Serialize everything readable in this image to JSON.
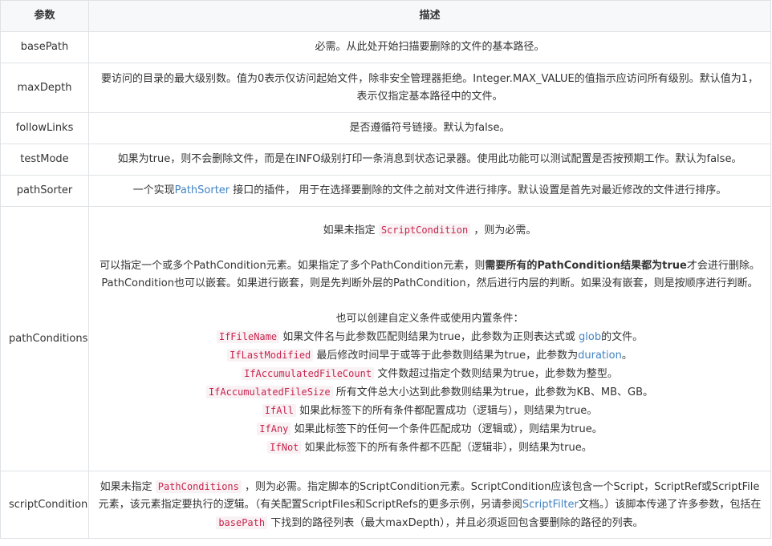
{
  "header": {
    "col1": "参数",
    "col2": "描述"
  },
  "rows": {
    "basePath": {
      "name": "basePath",
      "desc": "必需。从此处开始扫描要删除的文件的基本路径。"
    },
    "maxDepth": {
      "name": "maxDepth",
      "desc": "要访问的目录的最大级别数。值为0表示仅访问起始文件，除非安全管理器拒绝。Integer.MAX_VALUE的值指示应访问所有级别。默认值为1，表示仅指定基本路径中的文件。"
    },
    "followLinks": {
      "name": "followLinks",
      "desc": "是否遵循符号链接。默认为false。"
    },
    "testMode": {
      "name": "testMode",
      "desc": "如果为true，则不会删除文件，而是在INFO级别打印一条消息到状态记录器。使用此功能可以测试配置是否按预期工作。默认为false。"
    },
    "pathSorter": {
      "name": "pathSorter",
      "pre": "一个实现",
      "link": "PathSorter",
      "post": " 接口的插件， 用于在选择要删除的文件之前对文件进行排序。默认设置是首先对最近修改的文件进行排序。"
    },
    "pathConditions": {
      "name": "pathConditions",
      "p1_pre": "如果未指定 ",
      "p1_code": "ScriptCondition",
      "p1_post": " ，则为必需。",
      "p2_pre": "可以指定一个或多个PathCondition元素。如果指定了多个PathCondition元素，则",
      "p2_bold": "需要所有的PathCondition结果都为true",
      "p2_post": "才会进行删除。PathCondition也可以嵌套。如果进行嵌套，则是先判断外层的PathCondition，然后进行内层的判断。如果没有嵌套，则是按顺序进行判断。",
      "p3": "也可以创建自定义条件或使用内置条件：",
      "conds": [
        {
          "code": "IfFileName",
          "pre": " 如果文件名与此参数匹配则结果为true，此参数为正则表达式或 ",
          "link": "glob",
          "post": "的文件。"
        },
        {
          "code": "IfLastModified",
          "pre": " 最后修改时间早于或等于此参数则结果为true，此参数为",
          "link": "duration",
          "post": "。"
        },
        {
          "code": "IfAccumulatedFileCount",
          "pre": " 文件数超过指定个数则结果为true，此参数为整型。",
          "link": "",
          "post": ""
        },
        {
          "code": "IfAccumulatedFileSize",
          "pre": " 所有文件总大小达到此参数则结果为true，此参数为KB、MB、GB。",
          "link": "",
          "post": ""
        },
        {
          "code": "IfAll",
          "pre": " 如果此标签下的所有条件都配置成功（逻辑与），则结果为true。",
          "link": "",
          "post": ""
        },
        {
          "code": "IfAny",
          "pre": " 如果此标签下的任何一个条件匹配成功（逻辑或），则结果为true。",
          "link": "",
          "post": ""
        },
        {
          "code": "IfNot",
          "pre": " 如果此标签下的所有条件都不匹配（逻辑非），则结果为true。",
          "link": "",
          "post": ""
        }
      ]
    },
    "scriptCondition": {
      "name": "scriptCondition",
      "pre": "如果未指定 ",
      "code1": "PathConditions",
      "mid1": " ，则为必需。指定脚本的ScriptCondition元素。ScriptCondition应该包含一个Script，ScriptRef或ScriptFile元素，该元素指定要执行的逻辑。（有关配置ScriptFiles和ScriptRefs的更多示例，另请参阅",
      "link": "ScriptFilter",
      "mid2": "文档。）该脚本传递了许多参数，包括在 ",
      "code2": "basePath",
      "post": " 下找到的路径列表（最大maxDepth），并且必须返回包含要删除的路径的列表。"
    }
  }
}
